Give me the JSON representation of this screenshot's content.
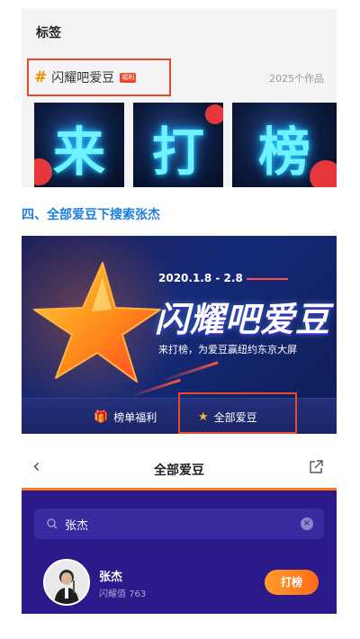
{
  "tag_card": {
    "title": "标签",
    "hash": "#",
    "tag_name": "闪耀吧爱豆",
    "badge": "福利",
    "works_count": "2025个作品",
    "posters": [
      "来",
      "打",
      "榜"
    ]
  },
  "step_heading": "四、全部爱豆下搜索张杰",
  "banner": {
    "date": "2020.1.8 - 2.8",
    "title": "闪耀吧爱豆",
    "subtitle": "来打榜，为爱豆赢纽约东京大屏",
    "btn_rank_gift": "榜单福利",
    "btn_all_idols": "全部爱豆"
  },
  "search_screen": {
    "nav_title": "全部爱豆",
    "back_icon": "‹",
    "search_value": "张杰",
    "clear_icon": "×",
    "result": {
      "name": "张杰",
      "score": "闪耀值 763",
      "button": "打榜"
    }
  },
  "colors": {
    "highlight_border": "#e8492b",
    "heading_blue": "#1d7fe0",
    "panel_purple": "#2a1a8a",
    "accent_orange": "#ff7a1a"
  }
}
